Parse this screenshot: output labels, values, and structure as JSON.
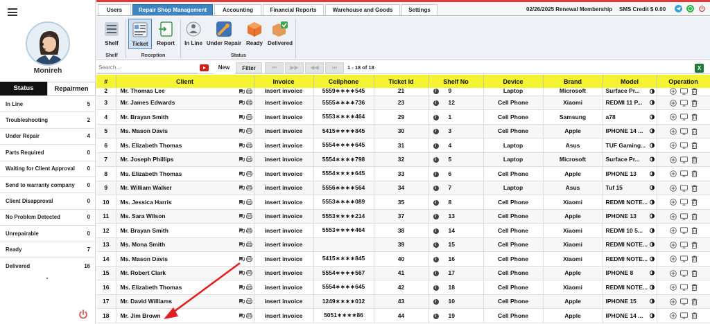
{
  "sidebar": {
    "username": "Monireh",
    "tabs": [
      "Status",
      "Repairmen"
    ],
    "statuses": [
      {
        "label": "In Line",
        "count": "5"
      },
      {
        "label": "Troubleshooting",
        "count": "2"
      },
      {
        "label": "Under Repair",
        "count": "4"
      },
      {
        "label": "Parts Required",
        "count": "0"
      },
      {
        "label": "Waiting for Client Approval",
        "count": "0"
      },
      {
        "label": "Send to warranty company",
        "count": "0"
      },
      {
        "label": "Client Disapproval",
        "count": "0"
      },
      {
        "label": "No Problem Detected",
        "count": "0"
      },
      {
        "label": "Unrepairable",
        "count": "0"
      },
      {
        "label": "Ready",
        "count": "7"
      },
      {
        "label": "Delivered",
        "count": "16"
      }
    ]
  },
  "nav": {
    "tabs": [
      "Users",
      "Repair Shop Management",
      "Accounting",
      "Financial Reports",
      "Warehouse and Goods",
      "Settings"
    ],
    "active": "Repair Shop Management",
    "renewal": "02/26/2025 Renewal Membership",
    "sms_credit": "SMS Credit $ 0.00"
  },
  "ribbon": {
    "buttons": {
      "shelf": "Shelf",
      "ticket": "Ticket",
      "report": "Report",
      "in_line": "In Line",
      "under_repair": "Under Repair",
      "ready": "Ready",
      "delivered": "Delivered"
    },
    "groups": {
      "shelf": "Shelf",
      "reception": "Reception",
      "status": "Status"
    }
  },
  "toolbar": {
    "search_placeholder": "Search...",
    "new_label": "New",
    "filter_label": "Filter",
    "pager_info": "1 - 18 of 18"
  },
  "table": {
    "headers": [
      "#",
      "Client",
      "Invoice",
      "Cellphone",
      "Ticket Id",
      "Shelf No",
      "Device",
      "Brand",
      "Model",
      "Operation"
    ],
    "rows": [
      {
        "n": "2",
        "client": "Mr. Thomas Lee",
        "invoice": "insert invoice",
        "phone": "5559∗∗∗∗545",
        "ticket": "21",
        "shelf": "9",
        "device": "Laptop",
        "brand": "Microsoft",
        "model": "Surface Pr..."
      },
      {
        "n": "3",
        "client": "Mr. James Edwards",
        "invoice": "insert invoice",
        "phone": "5555∗∗∗∗736",
        "ticket": "23",
        "shelf": "12",
        "device": "Cell Phone",
        "brand": "Xiaomi",
        "model": "REDMI 11 P..."
      },
      {
        "n": "4",
        "client": "Mr. Brayan Smith",
        "invoice": "insert invoice",
        "phone": "5553∗∗∗∗464",
        "ticket": "29",
        "shelf": "1",
        "device": "Cell Phone",
        "brand": "Samsung",
        "model": "a78"
      },
      {
        "n": "5",
        "client": "Ms. Mason Davis",
        "invoice": "insert invoice",
        "phone": "5415∗∗∗∗845",
        "ticket": "30",
        "shelf": "3",
        "device": "Cell Phone",
        "brand": "Apple",
        "model": "IPHONE 14 ..."
      },
      {
        "n": "6",
        "client": "Ms. Elizabeth Thomas",
        "invoice": "insert invoice",
        "phone": "5554∗∗∗∗645",
        "ticket": "31",
        "shelf": "4",
        "device": "Laptop",
        "brand": "Asus",
        "model": "TUF Gaming..."
      },
      {
        "n": "7",
        "client": "Mr. Joseph Phillips",
        "invoice": "insert invoice",
        "phone": "5554∗∗∗∗798",
        "ticket": "32",
        "shelf": "5",
        "device": "Laptop",
        "brand": "Microsoft",
        "model": "Surface Pr..."
      },
      {
        "n": "8",
        "client": "Ms. Elizabeth Thomas",
        "invoice": "insert invoice",
        "phone": "5554∗∗∗∗645",
        "ticket": "33",
        "shelf": "6",
        "device": "Cell Phone",
        "brand": "Apple",
        "model": "IPHONE 13"
      },
      {
        "n": "9",
        "client": "Mr. William Walker",
        "invoice": "insert invoice",
        "phone": "5556∗∗∗∗564",
        "ticket": "34",
        "shelf": "7",
        "device": "Laptop",
        "brand": "Asus",
        "model": "Tuf 15"
      },
      {
        "n": "10",
        "client": "Ms. Jessica Harris",
        "invoice": "insert invoice",
        "phone": "5553∗∗∗∗089",
        "ticket": "35",
        "shelf": "8",
        "device": "Cell Phone",
        "brand": "Xiaomi",
        "model": "REDMI NOTE..."
      },
      {
        "n": "11",
        "client": "Ms. Sara Wilson",
        "invoice": "insert invoice",
        "phone": "5553∗∗∗∗214",
        "ticket": "37",
        "shelf": "13",
        "device": "Cell Phone",
        "brand": "Apple",
        "model": "IPHONE 13"
      },
      {
        "n": "12",
        "client": "Mr. Brayan Smith",
        "invoice": "insert invoice",
        "phone": "5553∗∗∗∗464",
        "ticket": "38",
        "shelf": "14",
        "device": "Cell Phone",
        "brand": "Xiaomi",
        "model": "REDMI 10 5..."
      },
      {
        "n": "13",
        "client": "Ms. Mona Smith",
        "invoice": "insert invoice",
        "phone": "",
        "ticket": "39",
        "shelf": "15",
        "device": "Cell Phone",
        "brand": "Xiaomi",
        "model": "REDMI NOTE..."
      },
      {
        "n": "14",
        "client": "Ms. Mason Davis",
        "invoice": "insert invoice",
        "phone": "5415∗∗∗∗845",
        "ticket": "40",
        "shelf": "16",
        "device": "Cell Phone",
        "brand": "Xiaomi",
        "model": "REDMI NOTE..."
      },
      {
        "n": "15",
        "client": "Mr. Robert Clark",
        "invoice": "insert invoice",
        "phone": "5554∗∗∗∗567",
        "ticket": "41",
        "shelf": "17",
        "device": "Cell Phone",
        "brand": "Apple",
        "model": "IPHONE 8"
      },
      {
        "n": "16",
        "client": "Ms. Elizabeth Thomas",
        "invoice": "insert invoice",
        "phone": "5554∗∗∗∗645",
        "ticket": "42",
        "shelf": "18",
        "device": "Cell Phone",
        "brand": "Xiaomi",
        "model": "REDMI NOTE..."
      },
      {
        "n": "17",
        "client": "Mr. David Williams",
        "invoice": "insert invoice",
        "phone": "1249∗∗∗∗012",
        "ticket": "43",
        "shelf": "10",
        "device": "Cell Phone",
        "brand": "Apple",
        "model": "IPHONE 15"
      },
      {
        "n": "18",
        "client": "Mr. Jim Brown",
        "invoice": "insert invoice",
        "phone": "5051∗∗∗∗86",
        "ticket": "44",
        "shelf": "19",
        "device": "Cell Phone",
        "brand": "Apple",
        "model": "IPHONE 14 ..."
      }
    ]
  },
  "colors": {
    "header_yellow": "#f4f432",
    "active_tab_blue": "#3e84c2",
    "accent_red": "#e03a3a"
  }
}
